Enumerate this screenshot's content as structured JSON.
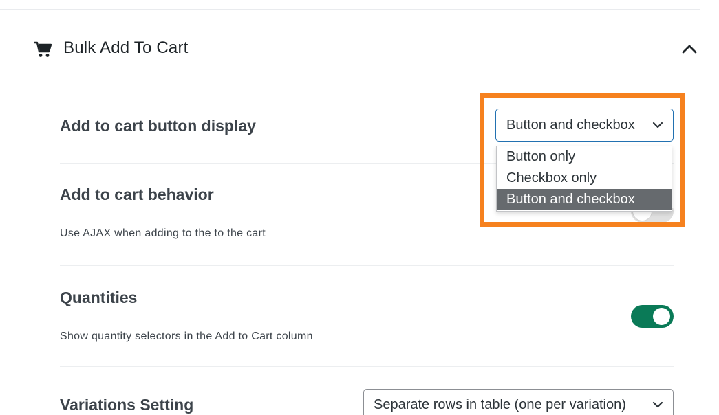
{
  "section": {
    "title": "Bulk Add To Cart",
    "icon": "cart-icon",
    "collapse_icon": "chevron-up-icon"
  },
  "settings": {
    "display": {
      "label": "Add to cart button display",
      "selected": "Button and checkbox",
      "options": [
        "Button only",
        "Checkbox only",
        "Button and checkbox"
      ]
    },
    "behavior": {
      "label": "Add to cart behavior",
      "description": "Use AJAX when adding to the to the cart"
    },
    "quantities": {
      "label": "Quantities",
      "description": "Show quantity selectors in the Add to Cart column",
      "enabled": true
    },
    "variations": {
      "label": "Variations Setting",
      "selected": "Separate rows in table (one per variation)"
    }
  },
  "colors": {
    "highlight": "#f6811e",
    "toggle_on": "#0a7a57",
    "focus": "#2271b1",
    "selected_option": "#666a6e"
  }
}
